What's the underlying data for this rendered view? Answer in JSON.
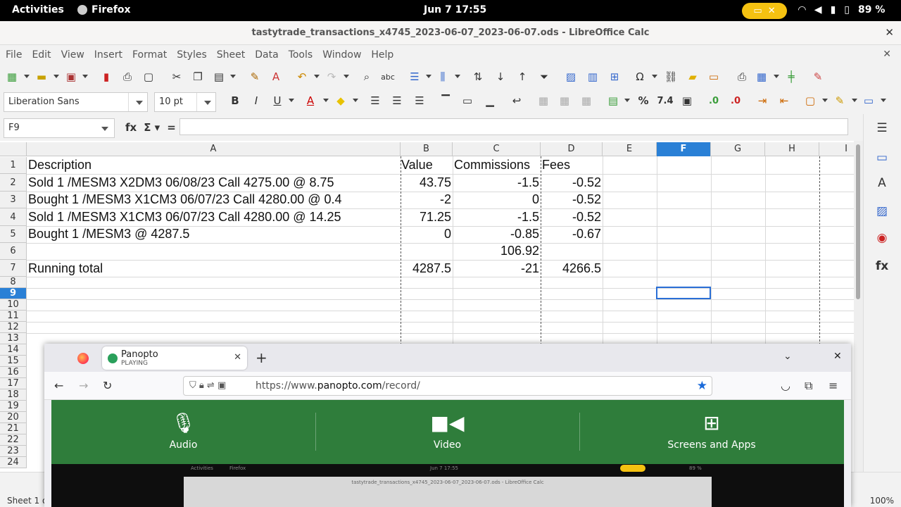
{
  "topbar": {
    "activities": "Activities",
    "app": "Firefox",
    "clock": "Jun 7  17:55",
    "battery": "89 %"
  },
  "window": {
    "title": "tastytrade_transactions_x4745_2023-06-07_2023-06-07.ods - LibreOffice Calc"
  },
  "menu": [
    "File",
    "Edit",
    "View",
    "Insert",
    "Format",
    "Styles",
    "Sheet",
    "Data",
    "Tools",
    "Window",
    "Help"
  ],
  "format": {
    "font_name": "Liberation Sans",
    "font_size": "10 pt"
  },
  "formula": {
    "cell_ref": "F9",
    "content": ""
  },
  "columns": [
    "A",
    "B",
    "C",
    "D",
    "E",
    "F",
    "G",
    "H",
    "I"
  ],
  "selected_column": "F",
  "selected_row": "9",
  "rows": [
    "1",
    "2",
    "3",
    "4",
    "5",
    "6",
    "7",
    "8",
    "9",
    "10",
    "11",
    "12",
    "13",
    "14",
    "15",
    "16",
    "17",
    "18",
    "19",
    "20",
    "21",
    "22",
    "23",
    "24"
  ],
  "cells": {
    "r1": {
      "a": "Description",
      "b": "Value",
      "c": "Commissions",
      "d": "Fees"
    },
    "r2": {
      "a": "Sold 1 /MESM3 X2DM3 06/08/23 Call 4275.00 @ 8.75",
      "b": "43.75",
      "c": "-1.5",
      "d": "-0.52"
    },
    "r3": {
      "a": "Bought 1 /MESM3 X1CM3 06/07/23 Call 4280.00 @ 0.4",
      "b": "-2",
      "c": "0",
      "d": "-0.52"
    },
    "r4": {
      "a": "Sold 1 /MESM3 X1CM3 06/07/23 Call 4280.00 @ 14.25",
      "b": "71.25",
      "c": "-1.5",
      "d": "-0.52"
    },
    "r5": {
      "a": "Bought 1 /MESM3 @ 4287.5",
      "b": "0",
      "c": "-0.85",
      "d": "-0.67"
    },
    "r6": {
      "a": "",
      "b": "",
      "c": "106.92",
      "d": ""
    },
    "r7": {
      "a": "Running total",
      "b": "4287.5",
      "c": "-21",
      "d": "4266.5"
    }
  },
  "statusbar": {
    "sheet": "Sheet 1 of 1",
    "zoom": "100%"
  },
  "firefox": {
    "tab_title": "Panopto",
    "tab_status": "PLAYING",
    "url_prefix": "https://www.",
    "url_domain": "panopto.com",
    "url_path": "/record/",
    "record_options": [
      {
        "label": "Audio",
        "icon": "microphone-icon"
      },
      {
        "label": "Video",
        "icon": "video-camera-icon"
      },
      {
        "label": "Screens and Apps",
        "icon": "screen-add-icon"
      }
    ],
    "preview": {
      "activities": "Activities",
      "app": "Firefox",
      "clock": "Jun 7  17:55",
      "battery": "89 %",
      "title": "tastytrade_transactions_x4745_2023-06-07_2023-06-07.ods - LibreOffice Calc"
    }
  }
}
